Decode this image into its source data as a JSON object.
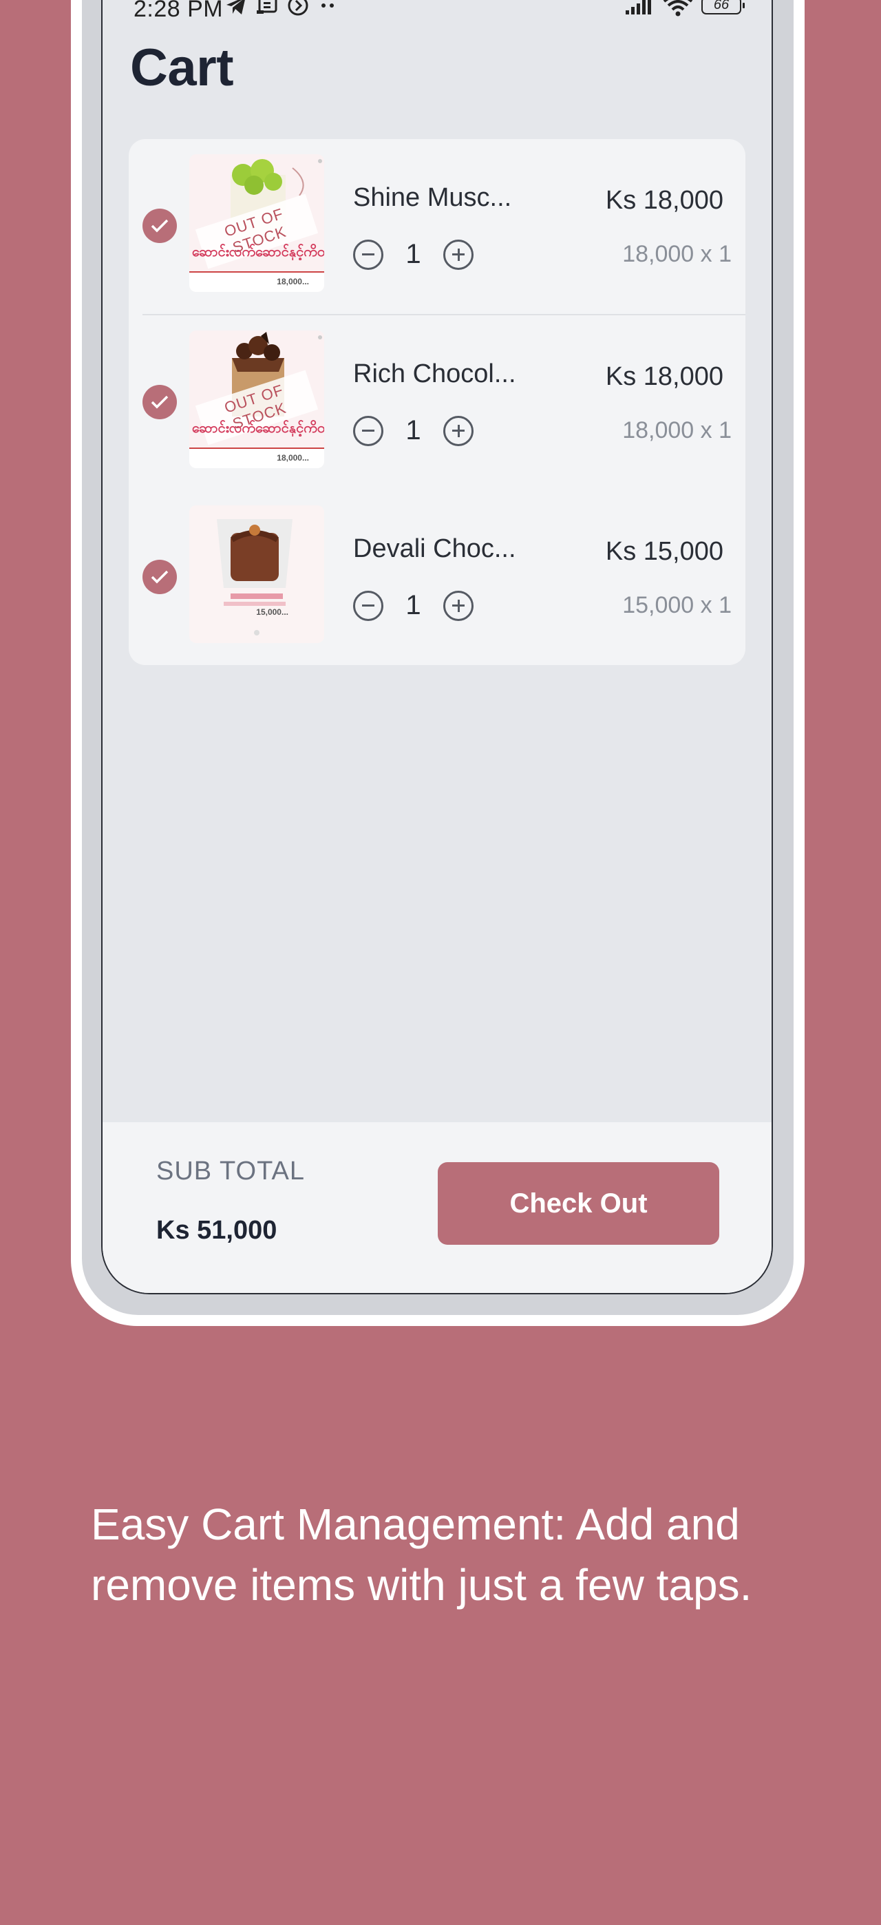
{
  "status_bar": {
    "time": "2:28 PM",
    "battery": "66",
    "icons": [
      "telegram-icon",
      "usb-debug-icon",
      "data-saver-icon",
      "more-dots-icon",
      "signal-icon",
      "wifi-icon",
      "battery-icon"
    ]
  },
  "page": {
    "title": "Cart"
  },
  "cart": {
    "items": [
      {
        "name": "Shine Musc...",
        "quantity": "1",
        "price": "Ks 18,000",
        "unit": "18,000 x 1",
        "out_of_stock": "OUT OF STOCK",
        "poster_text": "ဆောင်းလက်ဆောင်နှင့်ကိတ်",
        "poster_price": "18,000...",
        "checked": true
      },
      {
        "name": "Rich Chocol...",
        "quantity": "1",
        "price": "Ks 18,000",
        "unit": "18,000 x 1",
        "out_of_stock": "OUT OF STOCK",
        "poster_text": "ဆောင်းလက်ဆောင်နှင့်ကိတ်",
        "poster_price": "18,000...",
        "checked": true
      },
      {
        "name": "Devali Choc...",
        "quantity": "1",
        "price": "Ks 15,000",
        "unit": "15,000 x 1",
        "out_of_stock": "",
        "poster_text": "",
        "poster_price": "15,000...",
        "checked": true
      }
    ]
  },
  "footer": {
    "sub_total_label": "SUB TOTAL",
    "sub_total_value": "Ks 51,000",
    "checkout_label": "Check Out"
  },
  "caption": "Easy Cart Management: Add and remove items with just a few taps.",
  "colors": {
    "accent": "#b86e78",
    "background": "#b86e78",
    "screen": "#e5e7eb",
    "card": "#f3f4f6"
  }
}
